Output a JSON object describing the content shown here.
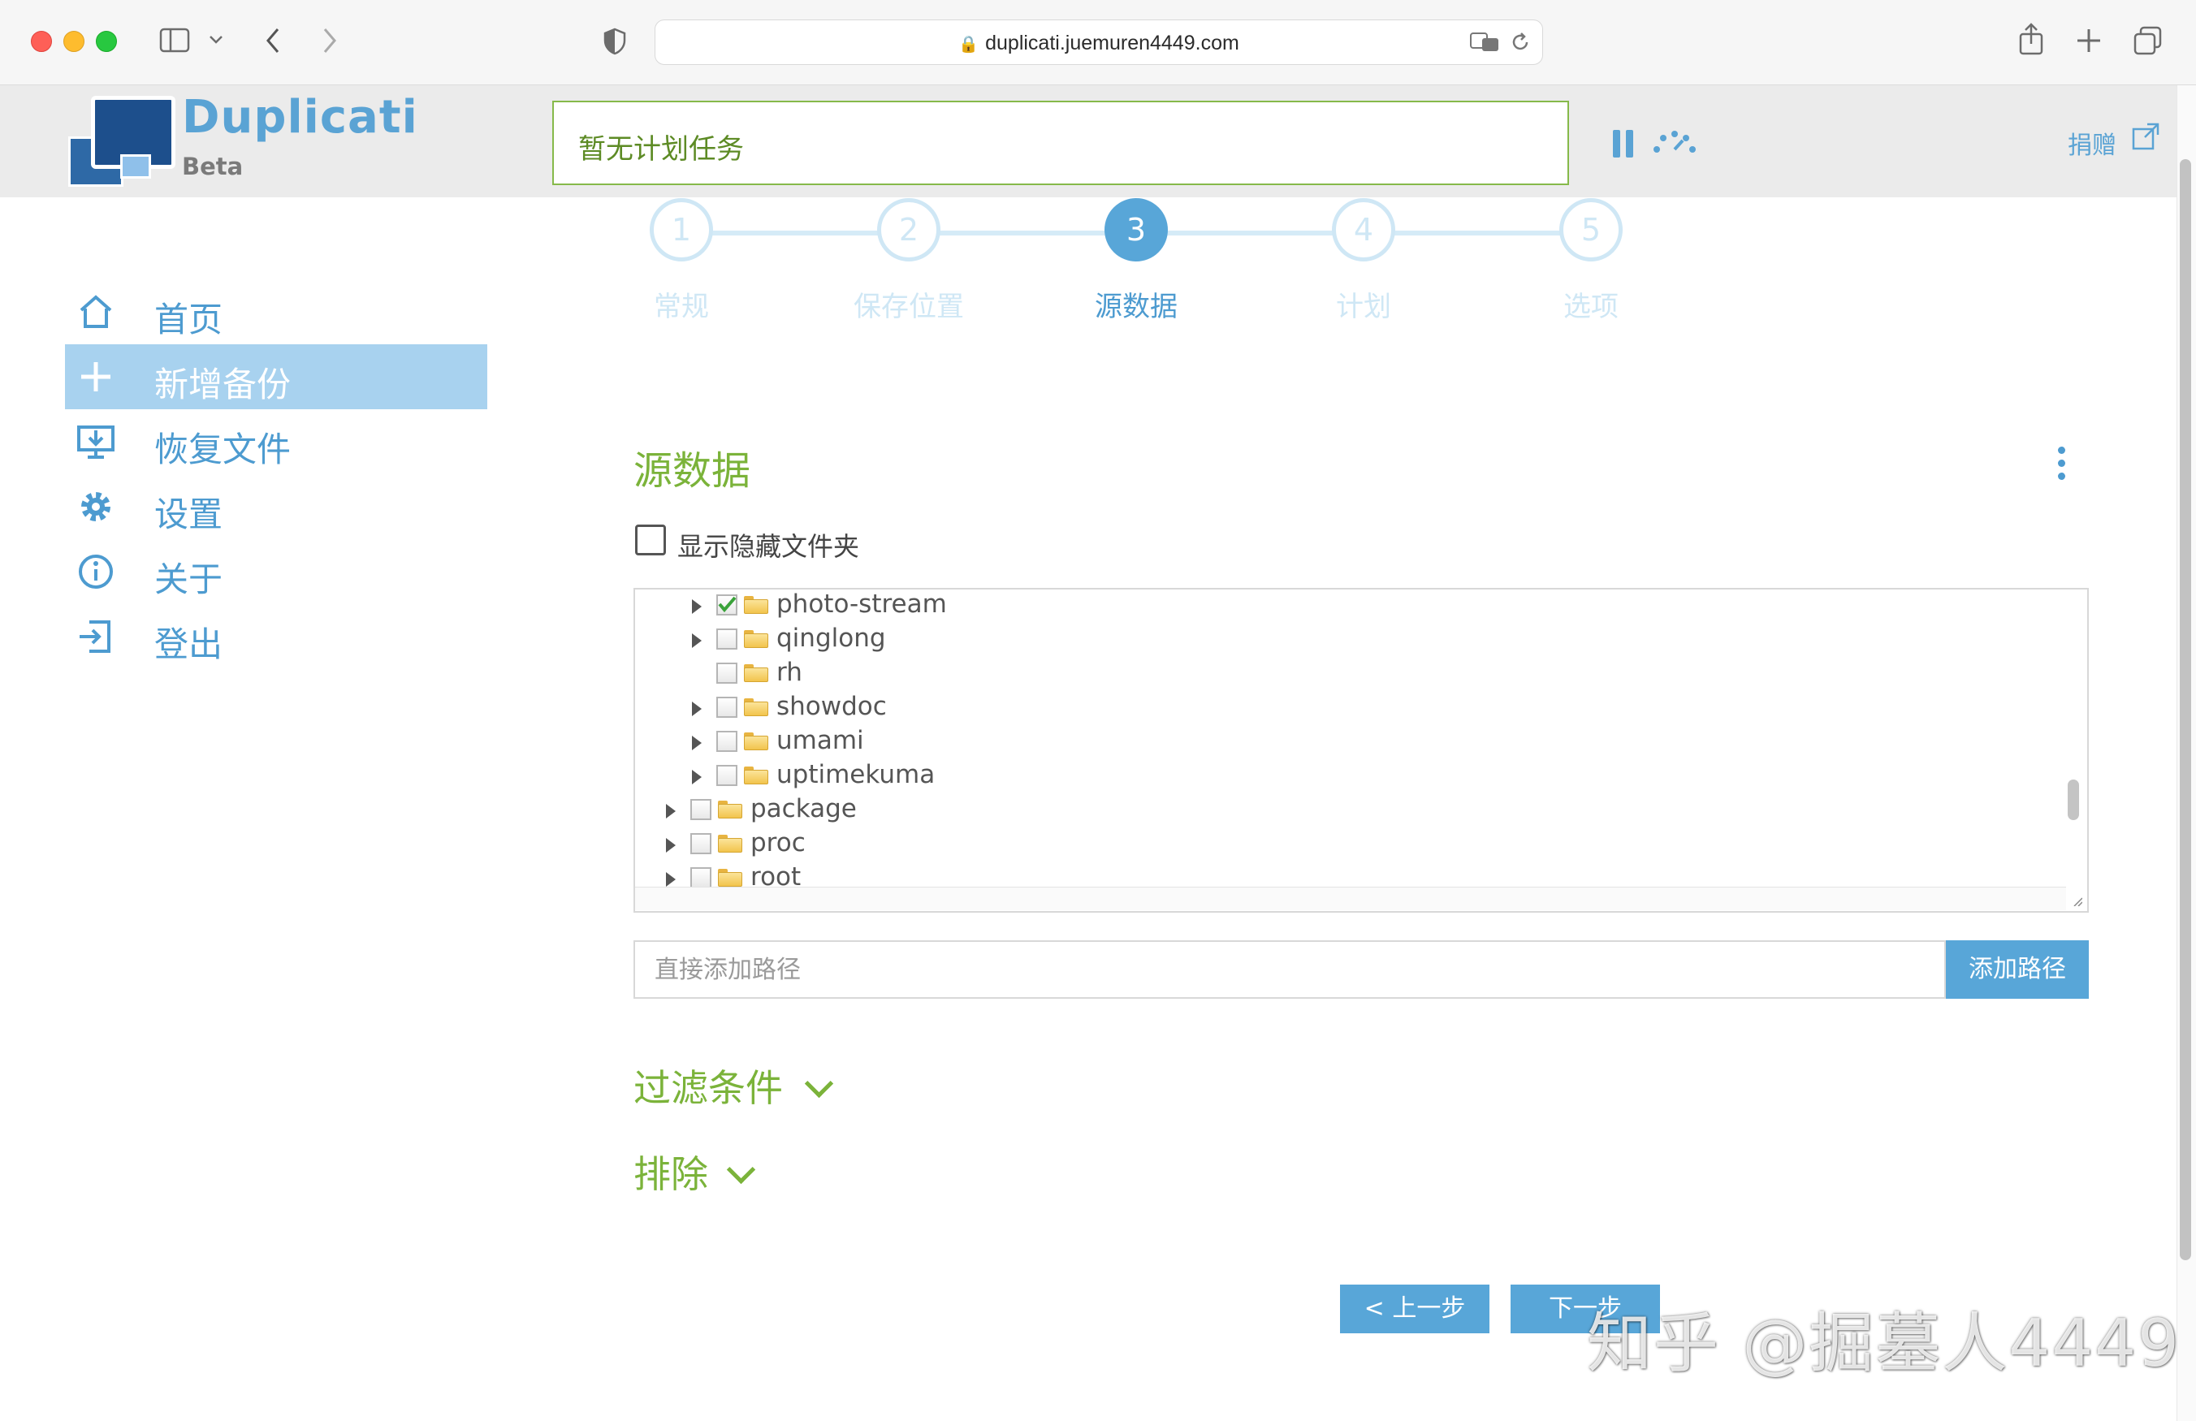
{
  "browser": {
    "url": "duplicati.juemuren4449.com"
  },
  "app": {
    "brand": "Duplicati",
    "beta": "Beta",
    "status_message": "暂无计划任务",
    "donate_label": "捐赠"
  },
  "sidebar": {
    "items": [
      {
        "label": "首页",
        "icon": "home-icon",
        "active": false
      },
      {
        "label": "新增备份",
        "icon": "plus-icon",
        "active": true
      },
      {
        "label": "恢复文件",
        "icon": "restore-icon",
        "active": false
      },
      {
        "label": "设置",
        "icon": "gear-icon",
        "active": false
      },
      {
        "label": "关于",
        "icon": "info-icon",
        "active": false
      },
      {
        "label": "登出",
        "icon": "logout-icon",
        "active": false
      }
    ]
  },
  "wizard": {
    "current_step": 3,
    "steps": [
      {
        "number": "1",
        "label": "常规"
      },
      {
        "number": "2",
        "label": "保存位置"
      },
      {
        "number": "3",
        "label": "源数据"
      },
      {
        "number": "4",
        "label": "计划"
      },
      {
        "number": "5",
        "label": "选项"
      }
    ]
  },
  "source": {
    "title": "源数据",
    "show_hidden_label": "显示隐藏文件夹",
    "show_hidden_checked": false,
    "tree": [
      {
        "name": "photo-stream",
        "level": 2,
        "expandable": true,
        "checked": true
      },
      {
        "name": "qinglong",
        "level": 2,
        "expandable": true,
        "checked": false
      },
      {
        "name": "rh",
        "level": 2,
        "expandable": false,
        "checked": false
      },
      {
        "name": "showdoc",
        "level": 2,
        "expandable": true,
        "checked": false
      },
      {
        "name": "umami",
        "level": 2,
        "expandable": true,
        "checked": false
      },
      {
        "name": "uptimekuma",
        "level": 2,
        "expandable": true,
        "checked": false
      },
      {
        "name": "package",
        "level": 1,
        "expandable": true,
        "checked": false
      },
      {
        "name": "proc",
        "level": 1,
        "expandable": true,
        "checked": false
      },
      {
        "name": "root",
        "level": 1,
        "expandable": true,
        "checked": false
      }
    ],
    "path_placeholder": "直接添加路径",
    "path_value": "",
    "add_path_label": "添加路径"
  },
  "filters": {
    "filter_title": "过滤条件",
    "exclude_title": "排除"
  },
  "nav_buttons": {
    "prev_label": "< 上一步",
    "next_label": "下一步"
  },
  "watermark": "知乎 @掘墓人4449",
  "colors": {
    "accent_blue": "#58a6d8",
    "accent_green": "#7bb33a",
    "active_nav_bg": "#a8d2ef"
  }
}
